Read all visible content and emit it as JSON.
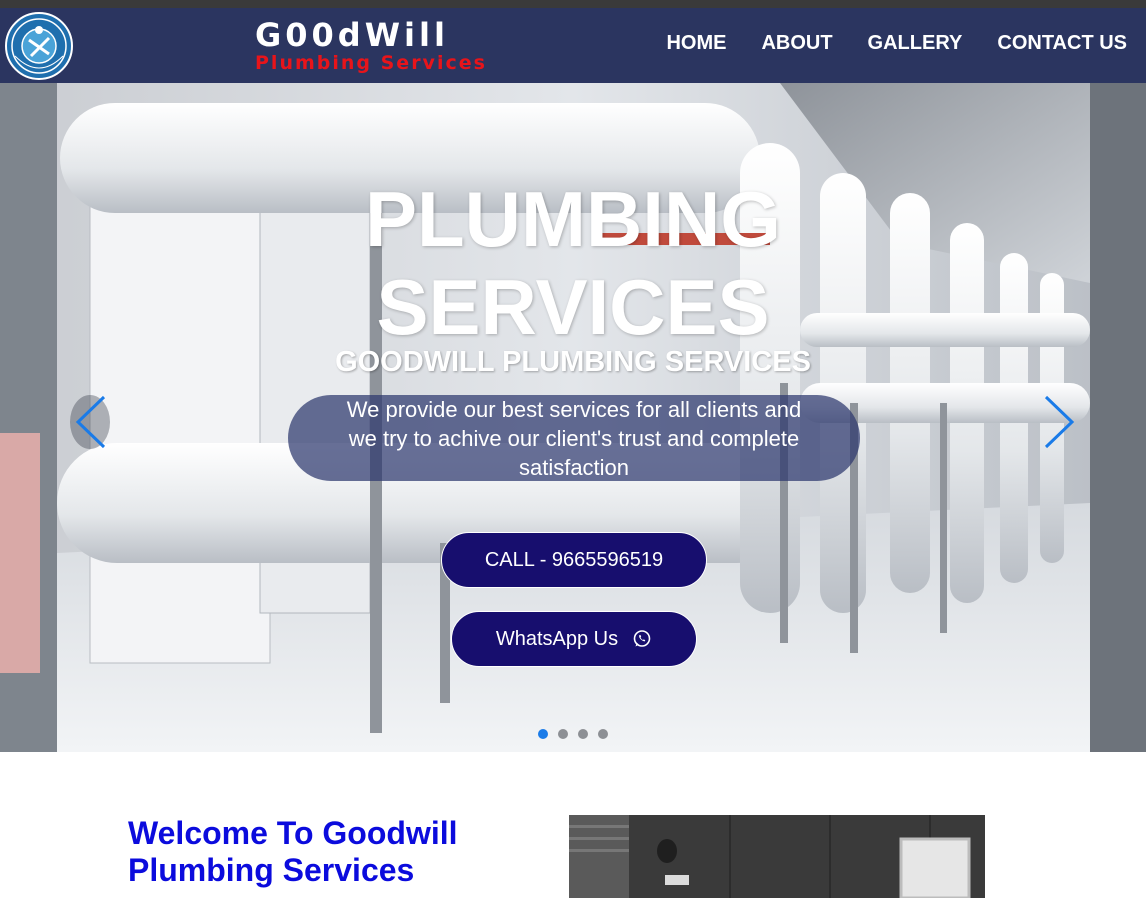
{
  "header": {
    "brand_name": "G00dWill",
    "brand_sub": "Plumbing Services",
    "logo_text": "PLUMBING SERVICES",
    "nav": [
      {
        "label": "HOME"
      },
      {
        "label": "ABOUT"
      },
      {
        "label": "GALLERY"
      },
      {
        "label": "CONTACT US"
      }
    ]
  },
  "hero": {
    "title_line1": "PLUMBING",
    "title_line2": "SERVICES",
    "subtitle": "GOODWILL PLUMBING SERVICES",
    "desc_line1": "We provide our best services for all clients and",
    "desc_line2": "we try to achive our client's trust and complete",
    "desc_line3": "satisfaction",
    "call_label": "CALL - 9665596519",
    "whatsapp_label": "WhatsApp Us",
    "slide_count": 4,
    "active_slide": 1
  },
  "welcome": {
    "line1": "Welcome To Goodwill",
    "line2": "Plumbing Services"
  },
  "colors": {
    "header_bg": "#2b3560",
    "brand_sub": "#e8141a",
    "button_bg": "#170e6e",
    "welcome_text": "#0b0bdd",
    "arrow": "#1a7be8"
  },
  "icons": [
    "logo-emblem",
    "chevron-left-icon",
    "chevron-right-icon",
    "whatsapp-icon"
  ]
}
